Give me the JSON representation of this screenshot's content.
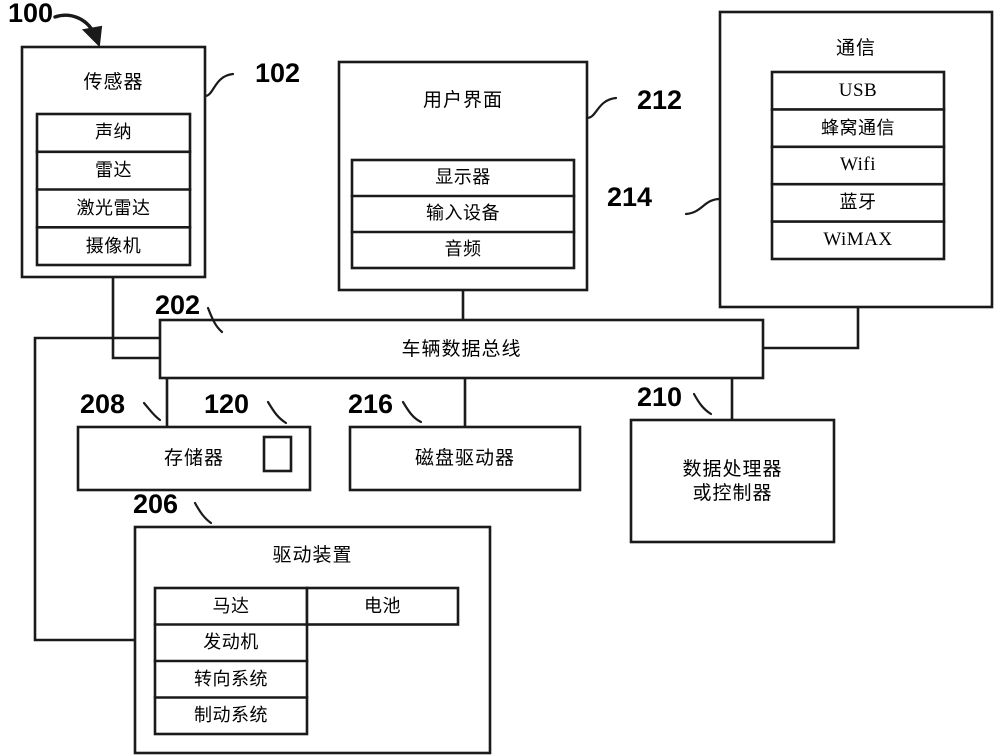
{
  "figure": {
    "label_100": "100",
    "type": "block-diagram"
  },
  "blocks": {
    "sensors": {
      "ref": "102",
      "title": "传感器",
      "items": [
        "声纳",
        "雷达",
        "激光雷达",
        "摄像机"
      ]
    },
    "user_interface": {
      "ref": "212",
      "title": "用户界面",
      "items": [
        "显示器",
        "输入设备",
        "音频"
      ]
    },
    "communications": {
      "ref": "214",
      "title": "通信",
      "items": [
        "USB",
        "蜂窝通信",
        "Wifi",
        "蓝牙",
        "WiMAX"
      ]
    },
    "data_bus": {
      "ref": "202",
      "title": "车辆数据总线"
    },
    "memory": {
      "ref": "208",
      "title": "存储器",
      "inner_ref": "120"
    },
    "disk_drive": {
      "ref": "216",
      "title": "磁盘驱动器"
    },
    "processor": {
      "ref": "210",
      "title": "数据处理器\n或控制器"
    },
    "drive_unit": {
      "ref": "206",
      "title": "驱动装置",
      "items": [
        "马达",
        "发动机",
        "转向系统",
        "制动系统"
      ],
      "battery": "电池"
    }
  },
  "style": {
    "line_color": "#1a1a1a",
    "background": "#ffffff"
  }
}
